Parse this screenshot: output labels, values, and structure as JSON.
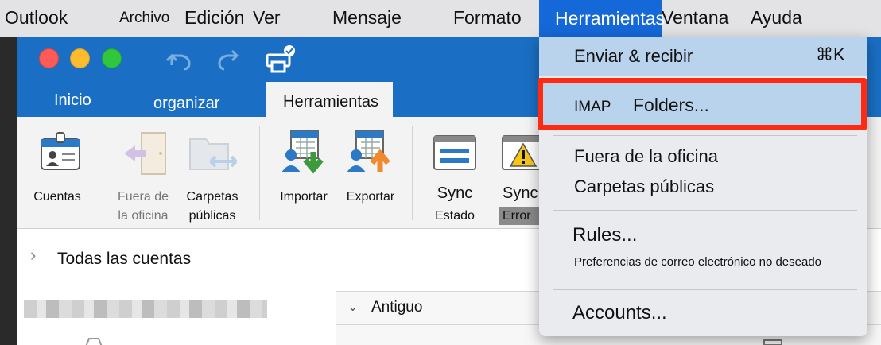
{
  "menubar": {
    "app": "Outlook",
    "items": [
      "Archivo",
      "Edición",
      "Ver",
      "Mensaje",
      "Formato",
      "Herramientas",
      "Ventana",
      "Ayuda"
    ]
  },
  "ribbon": {
    "tabs": [
      "Inicio",
      "organizar",
      "Herramientas"
    ],
    "buttons": {
      "cuentas": "Cuentas",
      "fuera_l1": "Fuera de",
      "fuera_l2": "la oficina",
      "carpetas_l1": "Carpetas",
      "carpetas_l2": "públicas",
      "importar": "Importar",
      "exportar": "Exportar",
      "sync_estado_l1": "Sync",
      "sync_estado_l2": "Estado",
      "sync_error_l1": "Sync",
      "sync_error_l2": "Error"
    }
  },
  "sidebar": {
    "all_accounts": "Todas las cuentas"
  },
  "mainpane": {
    "sort_label": "Antiguo"
  },
  "dropdown": {
    "send_receive": "Enviar & recibir",
    "send_receive_shortcut": "⌘K",
    "imap_prefix": "IMAP",
    "imap_folders": "Folders...",
    "out_of_office": "Fuera de la oficina",
    "public_folders": "Carpetas públicas",
    "rules": "Rules...",
    "junk_prefs": "Preferencias de correo electrónico no deseado",
    "accounts": "Accounts..."
  },
  "colors": {
    "highlight": "#ff2a10",
    "accent": "#1a6fc4",
    "menu_selected": "#1568d8"
  }
}
